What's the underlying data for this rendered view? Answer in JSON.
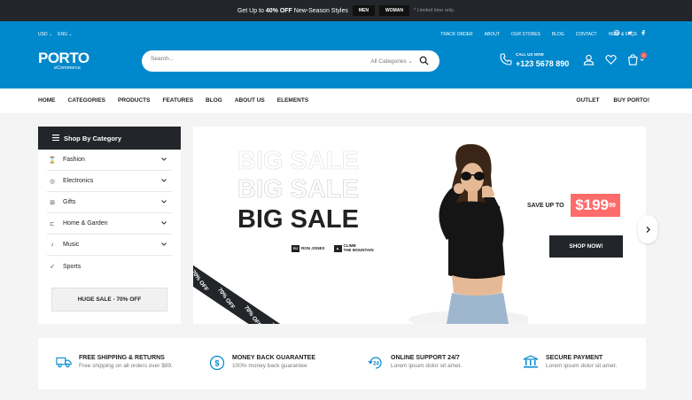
{
  "promo": {
    "text_prefix": "Get Up to ",
    "text_bold": "40% OFF",
    "text_suffix": " New-Season Styles",
    "btn_men": "MEN",
    "btn_woman": "WOMAN",
    "limited": "* Limited time only."
  },
  "topbar": {
    "currency": "USD",
    "language": "ENG",
    "links": [
      "TRACK ORDER",
      "ABOUT",
      "OUR STORES",
      "BLOG",
      "CONTACT",
      "HELP & FAQS"
    ],
    "social": [
      "instagram-icon",
      "twitter-icon",
      "facebook-icon"
    ]
  },
  "logo": {
    "wordmark": "PORTO",
    "sub": "eCommerce"
  },
  "search": {
    "placeholder": "Search...",
    "category": "All Categories"
  },
  "callus": {
    "label": "CALL US NOW",
    "number": "+123 5678 890"
  },
  "cart": {
    "count": "3"
  },
  "mainnav": {
    "left": [
      "HOME",
      "CATEGORIES",
      "PRODUCTS",
      "FEATURES",
      "BLOG",
      "ABOUT US",
      "ELEMENTS"
    ],
    "right": [
      "OUTLET",
      "BUY PORTO!"
    ]
  },
  "sidebar": {
    "title": "Shop By Category",
    "items": [
      {
        "label": "Fashion",
        "icon": "hourglass-icon"
      },
      {
        "label": "Electronics",
        "icon": "globe-icon"
      },
      {
        "label": "Gifts",
        "icon": "gift-icon"
      },
      {
        "label": "Home & Garden",
        "icon": "chair-icon"
      },
      {
        "label": "Music",
        "icon": "microphone-icon"
      },
      {
        "label": "Sports",
        "icon": "sports-icon"
      }
    ],
    "huge_sale": "HUGE SALE - 70% OFF"
  },
  "banner": {
    "big_sale": "BIG SALE",
    "ribbon": "70% OFF",
    "brand1": "RON JONES",
    "brand2a": "CLIMB",
    "brand2b": "THE MOUNTAIN",
    "save_up_to": "SAVE UP TO",
    "price": "$199",
    "price_cents": "99",
    "shop_now": "SHOP NOW!"
  },
  "features": [
    {
      "title": "FREE SHIPPING & RETURNS",
      "desc": "Free shipping on all orders over $99.",
      "icon": "truck-icon"
    },
    {
      "title": "MONEY BACK GUARANTEE",
      "desc": "100% money back guarantee",
      "icon": "dollar-icon"
    },
    {
      "title": "ONLINE SUPPORT 24/7",
      "desc": "Lorem ipsum dolor sit amet.",
      "icon": "support-icon"
    },
    {
      "title": "SECURE PAYMENT",
      "desc": "Lorem ipsum dolor sit amet.",
      "icon": "bank-icon"
    }
  ],
  "colors": {
    "primary": "#0088cc",
    "dark": "#222529",
    "accent": "#ff6b6b"
  }
}
